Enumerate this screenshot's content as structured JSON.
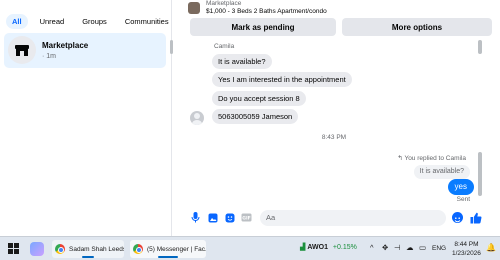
{
  "filters": [
    "All",
    "Unread",
    "Groups",
    "Communities"
  ],
  "conversation": {
    "name": "Marketplace",
    "time": "· 1m"
  },
  "listing": {
    "label": "Marketplace",
    "title": "$1,000 - 3 Beds 2 Baths Apartment/condo"
  },
  "actions": {
    "pending": "Mark as pending",
    "more": "More options"
  },
  "thread": {
    "sender": "Camila",
    "incoming": [
      "It is available?",
      "Yes I am interested in the appointment",
      "Do you accept session 8",
      "5063005059 Jameson"
    ],
    "timestamp": "8:43 PM",
    "replied_note": "You replied to Camila",
    "quoted": "It is available?",
    "outgoing": "yes",
    "status": "Sent"
  },
  "composer": {
    "placeholder": "Aa"
  },
  "taskbar": {
    "apps": [
      "Sadam Shah Leeds ...",
      "(5) Messenger | Fac..."
    ],
    "stock_ticker": "AWO1",
    "stock_change": "+0.15%",
    "lang": "ENG",
    "time": "8:44 PM",
    "date": "1/23/2026"
  },
  "colors": {
    "accent": "#0866ff",
    "bubble_out": "#0a7cff",
    "bubble_in": "#e9eaee"
  }
}
